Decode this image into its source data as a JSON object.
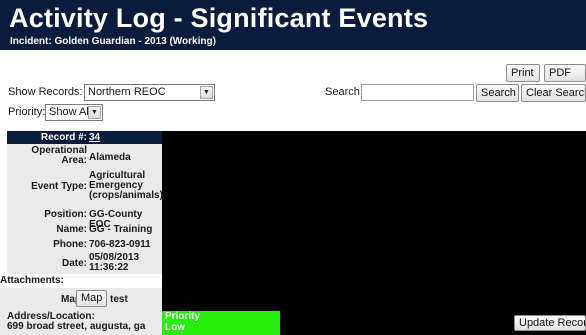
{
  "header": {
    "title": "Activity Log - Significant Events",
    "subtitle": "Incident: Golden Guardian - 2013 (Working)"
  },
  "toolbar": {
    "print_label": "Print",
    "pdf_label": "PDF",
    "search_label": "Search:",
    "search_value": "",
    "search_button_label": "Search",
    "clear_search_label": "Clear Search"
  },
  "filters": {
    "show_records_label": "Show Records:",
    "show_records_value": "Northern REOC",
    "priority_label": "Priority:",
    "priority_value": "Show All"
  },
  "record": {
    "record_label": "Record #:",
    "record_number": "34",
    "fields": [
      {
        "label": "Operational Area:",
        "value": "Alameda"
      },
      {
        "label": "Event Type:",
        "value": "Agricultural Emergency (crops/animals)"
      },
      {
        "label": "Position:",
        "value": "GG-County EOC"
      },
      {
        "label": "Name:",
        "value": "GG - Training"
      },
      {
        "label": "Phone:",
        "value": "706-823-0911"
      },
      {
        "label": "Date:",
        "value": "05/08/2013 11:36:22"
      }
    ],
    "attachments_label": "Attachments:",
    "map_label": "Map:",
    "map_button_label": "Map",
    "map_text": "test",
    "address_label": "Address/Location:",
    "address_value": "699 broad street, augusta, ga",
    "priority_label": "Priority",
    "priority_value": "Low",
    "update_button_label": "Update Record"
  },
  "colors": {
    "header_bg": "#0a1c3e",
    "priority_low": "#28ee10",
    "panel_gray": "#eaeaea"
  }
}
